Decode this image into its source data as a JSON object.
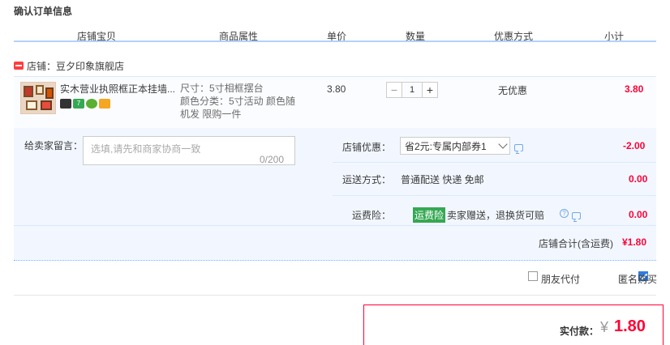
{
  "page_title": "确认订单信息",
  "columns": [
    "店铺宝贝",
    "商品属性",
    "单价",
    "数量",
    "优惠方式",
    "小计"
  ],
  "shop": {
    "label": "店铺：",
    "name": "豆夕印象旗舰店"
  },
  "item": {
    "title": "实木营业执照框正本挂墙...",
    "badges": [
      {
        "icon": "seller-badge-icon",
        "color": "#333333",
        "text": ""
      },
      {
        "icon": "seven-day-return-icon",
        "color": "#35a853",
        "text": "7"
      },
      {
        "icon": "quality-badge-icon",
        "color": "#5ab030",
        "text": ""
      },
      {
        "icon": "card-payment-icon",
        "color": "#f5a623",
        "text": ""
      }
    ],
    "attrs": [
      "尺寸：5寸相框摆台",
      "颜色分类：5寸活动 颜色随",
      "机发 限购一件"
    ],
    "price": "3.80",
    "quantity": "1",
    "minus": "−",
    "plus": "+",
    "discount": "无优惠",
    "subtotal": "3.80"
  },
  "message": {
    "label": "给卖家留言：",
    "placeholder": "选填,请先和商家协商一致",
    "count": "0/200"
  },
  "options": {
    "shop_discount": {
      "label": "店铺优惠：",
      "selected": "省2元:专属内部券1",
      "value": "-2.00"
    },
    "shipping": {
      "label": "运送方式：",
      "text": "普通配送 快递 免邮",
      "value": "0.00"
    },
    "insurance": {
      "label": "运费险：",
      "tag": "运费险",
      "text": "卖家赠送，退换货可赔",
      "help": "?",
      "value": "0.00"
    }
  },
  "shop_total": {
    "label": "店铺合计(含运费)",
    "value": "¥1.80"
  },
  "checkboxes": {
    "friend_pay": {
      "label": "朋友代付",
      "checked": false
    },
    "anonymous": {
      "label": "匿名购买",
      "checked": true
    }
  },
  "payment": {
    "label": "实付款：",
    "currency": "¥",
    "amount": "1.80"
  },
  "colors": {
    "accent_red": "#ff0036",
    "header_line": "#b2d1ff",
    "panel_bg": "#f2f7ff"
  }
}
